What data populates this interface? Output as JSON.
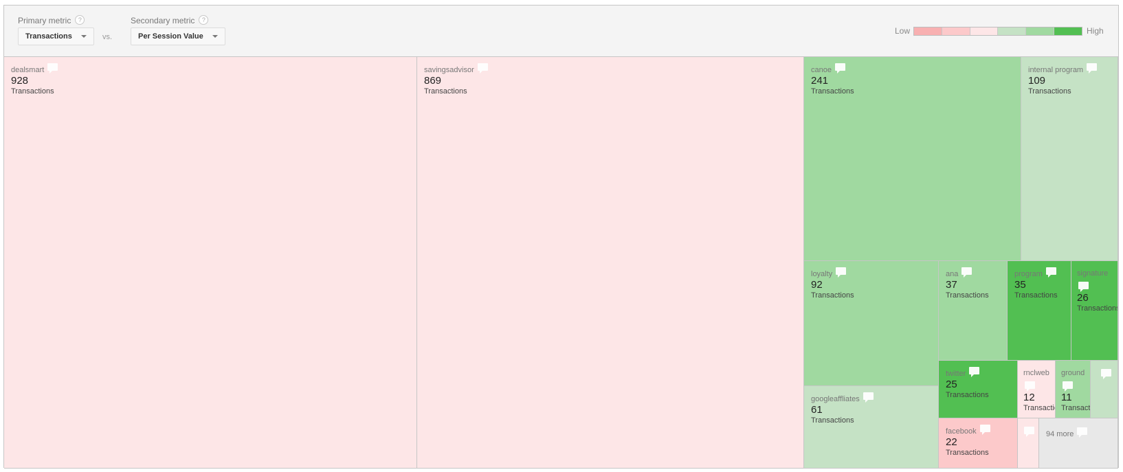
{
  "header": {
    "primary_metric_label": "Primary metric",
    "secondary_metric_label": "Secondary metric",
    "help_glyph": "?",
    "primary_metric_value": "Transactions",
    "secondary_metric_value": "Per Session Value",
    "vs_label": "vs.",
    "legend_low": "Low",
    "legend_high": "High",
    "legend_colors": [
      "#f8b0b1",
      "#fcc9ca",
      "#fde6e7",
      "#c5e2c5",
      "#a0d9a0",
      "#52bf52"
    ]
  },
  "chart_data": {
    "type": "treemap",
    "primary_metric": "Transactions",
    "secondary_metric": "Per Session Value",
    "color_scale": [
      "Low",
      "High"
    ],
    "unit_label": "Transactions",
    "items": [
      {
        "name": "dealsmart",
        "value": 928,
        "color_level": 3,
        "color": "#fde6e7"
      },
      {
        "name": "savingsadvisor",
        "value": 869,
        "color_level": 3,
        "color": "#fde6e7"
      },
      {
        "name": "canoe",
        "value": 241,
        "color_level": 5,
        "color": "#a0d9a0"
      },
      {
        "name": "internal program",
        "value": 109,
        "color_level": 4,
        "color": "#c5e2c5"
      },
      {
        "name": "loyalty",
        "value": 92,
        "color_level": 5,
        "color": "#a0d9a0"
      },
      {
        "name": "googleaffliates",
        "value": 61,
        "color_level": 4,
        "color": "#c5e2c5"
      },
      {
        "name": "ana",
        "value": 37,
        "color_level": 5,
        "color": "#a0d9a0"
      },
      {
        "name": "program",
        "value": 35,
        "color_level": 6,
        "color": "#52bf52"
      },
      {
        "name": "signature",
        "value": 26,
        "color_level": 6,
        "color": "#52bf52"
      },
      {
        "name": "twitter",
        "value": 25,
        "color_level": 6,
        "color": "#52bf52"
      },
      {
        "name": "facebook",
        "value": 22,
        "color_level": 2,
        "color": "#fcc9ca"
      },
      {
        "name": "rnclweb",
        "value": 12,
        "color_level": 3,
        "color": "#fde6e7"
      },
      {
        "name": "ground",
        "value": 11,
        "color_level": 5,
        "color": "#a0d9a0"
      },
      {
        "name": "",
        "value": null,
        "color_level": 4,
        "color": "#c5e2c5"
      },
      {
        "name": "",
        "value": null,
        "color_level": 3,
        "color": "#fde6e7"
      }
    ],
    "more": {
      "label": "94 more",
      "count": 94,
      "color": "#e8e8e8"
    }
  }
}
